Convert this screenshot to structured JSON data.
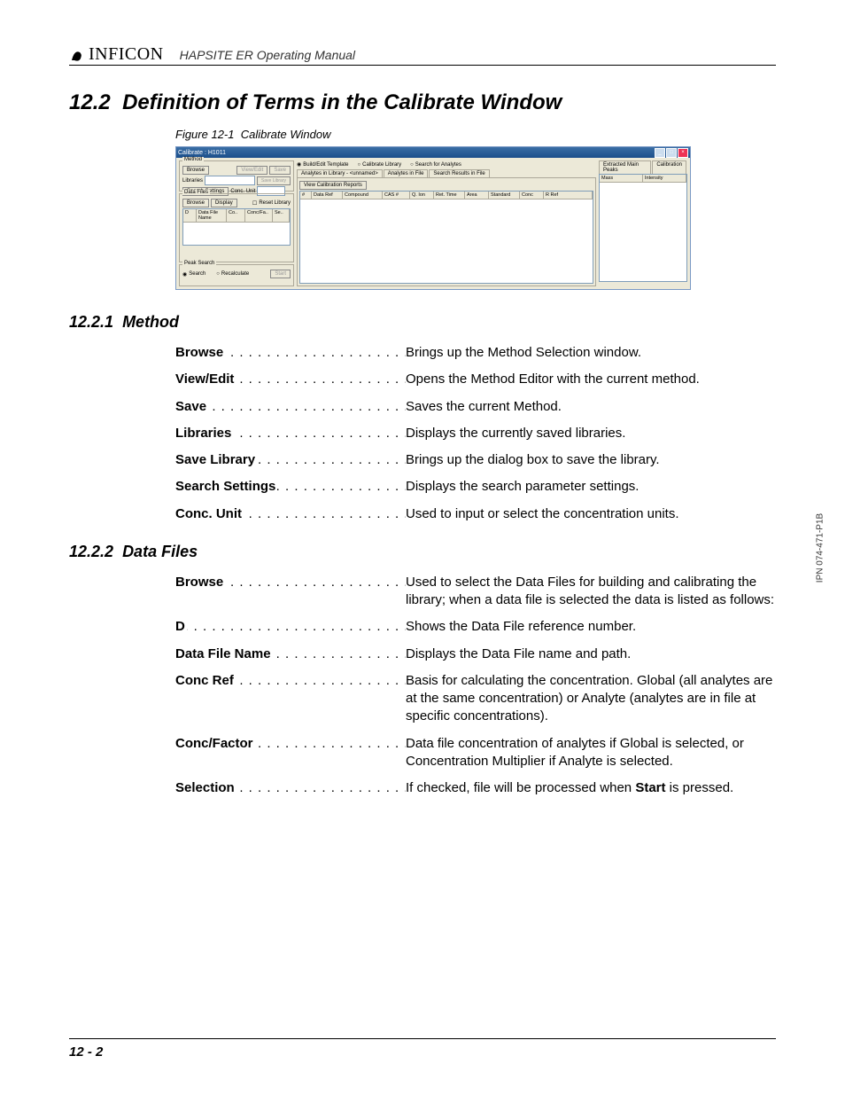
{
  "header": {
    "brand": "INFICON",
    "manual_title": "HAPSITE ER Operating Manual"
  },
  "section": {
    "number": "12.2",
    "title": "Definition of Terms in the Calibrate Window"
  },
  "figure": {
    "label": "Figure 12-1",
    "title": "Calibrate Window"
  },
  "screenshot": {
    "window_title": "Calibrate : H1011",
    "method_group": "Method",
    "browse_btn": "Browse",
    "viewedit_btn": "View/Edit",
    "save_btn": "Save",
    "libraries_label": "Libraries",
    "savelib_btn": "Save Library",
    "search_settings_btn": "Search Settings",
    "conc_unit_label": "Conc. Unit",
    "datafiles_group": "Data Files",
    "display_btn": "Display",
    "reset_lib_chk": "Reset Library",
    "df_cols": {
      "d": "D",
      "name": "Data File Name",
      "co": "Co..",
      "cf": "Conc/Fa..",
      "se": "Se.."
    },
    "peak_search_group": "Peak Search",
    "search_radio": "Search",
    "recalc_radio": "Recalculate",
    "start_btn": "Start",
    "top_radios": {
      "build": "Build/Edit Template",
      "calib": "Calibrate Library",
      "search": "Search for Analytes"
    },
    "mid_tabs": {
      "t1": "Analytes in Library - <unnamed>",
      "t2": "Analytes in File",
      "t3": "Search Results in File"
    },
    "view_cal_btn": "View Calibration Reports",
    "mid_cols": {
      "c1": "#",
      "c2": "Data Ref",
      "c3": "Compound",
      "c4": "CAS #",
      "c5": "Q. Ion",
      "c6": "Ret. Time",
      "c7": "Area",
      "c8": "Standard",
      "c9": "Conc",
      "c10": "R Ref"
    },
    "right_tabs": {
      "t1": "Extracted Main Peaks",
      "t2": "Calibration"
    },
    "right_cols": {
      "c1": "Mass",
      "c2": "Intensity"
    }
  },
  "sub1": {
    "number": "12.2.1",
    "title": "Method",
    "items": [
      {
        "term": "Browse",
        "desc": "Brings up the Method Selection window."
      },
      {
        "term": "View/Edit",
        "desc": "Opens the Method Editor with the current method."
      },
      {
        "term": "Save",
        "desc": "Saves the current Method."
      },
      {
        "term": "Libraries",
        "desc": "Displays the currently saved libraries."
      },
      {
        "term": "Save Library",
        "desc": "Brings up the dialog box to save the library."
      },
      {
        "term": "Search Settings",
        "desc": "Displays the search parameter settings."
      },
      {
        "term": "Conc. Unit",
        "desc": "Used to input or select the concentration units."
      }
    ]
  },
  "sub2": {
    "number": "12.2.2",
    "title": "Data Files",
    "items": [
      {
        "term": "Browse",
        "desc": "Used to select the Data Files for building and calibrating the library; when a data file is selected the data is listed as follows:"
      },
      {
        "term": "D",
        "desc": "Shows the Data File reference number."
      },
      {
        "term": "Data File Name",
        "desc": "Displays the Data File name and path."
      },
      {
        "term": "Conc Ref",
        "desc": "Basis for calculating the concentration. Global (all analytes are at the same concentration) or Analyte (analytes are in file at specific concentrations)."
      },
      {
        "term": "Conc/Factor",
        "desc": "Data file concentration of analytes if Global is selected, or Concentration Multiplier if Analyte is selected."
      },
      {
        "term": "Selection",
        "desc_prefix": "If checked, file will be processed when ",
        "desc_bold": "Start",
        "desc_suffix": " is pressed."
      }
    ]
  },
  "footer": {
    "page": "12 - 2"
  },
  "side": {
    "ipn": "IPN 074-471-P1B"
  }
}
